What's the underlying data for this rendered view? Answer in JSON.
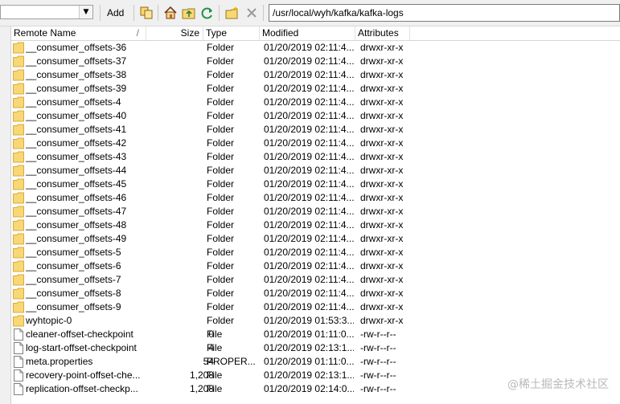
{
  "toolbar": {
    "add_label": "Add",
    "path": "/usr/local/wyh/kafka/kafka-logs",
    "icons": [
      "copy-icon",
      "home-icon",
      "parent-folder-icon",
      "refresh-icon",
      "new-folder-icon",
      "delete-icon"
    ]
  },
  "columns": {
    "name": "Remote Name",
    "name_sort": "/",
    "size": "Size",
    "type": "Type",
    "modified": "Modified",
    "attributes": "Attributes"
  },
  "files": [
    {
      "name": "__consumer_offsets-36",
      "size": "",
      "type": "Folder",
      "modified": "01/20/2019 02:11:4...",
      "attr": "drwxr-xr-x",
      "icon": "folder"
    },
    {
      "name": "__consumer_offsets-37",
      "size": "",
      "type": "Folder",
      "modified": "01/20/2019 02:11:4...",
      "attr": "drwxr-xr-x",
      "icon": "folder"
    },
    {
      "name": "__consumer_offsets-38",
      "size": "",
      "type": "Folder",
      "modified": "01/20/2019 02:11:4...",
      "attr": "drwxr-xr-x",
      "icon": "folder"
    },
    {
      "name": "__consumer_offsets-39",
      "size": "",
      "type": "Folder",
      "modified": "01/20/2019 02:11:4...",
      "attr": "drwxr-xr-x",
      "icon": "folder"
    },
    {
      "name": "__consumer_offsets-4",
      "size": "",
      "type": "Folder",
      "modified": "01/20/2019 02:11:4...",
      "attr": "drwxr-xr-x",
      "icon": "folder"
    },
    {
      "name": "__consumer_offsets-40",
      "size": "",
      "type": "Folder",
      "modified": "01/20/2019 02:11:4...",
      "attr": "drwxr-xr-x",
      "icon": "folder"
    },
    {
      "name": "__consumer_offsets-41",
      "size": "",
      "type": "Folder",
      "modified": "01/20/2019 02:11:4...",
      "attr": "drwxr-xr-x",
      "icon": "folder"
    },
    {
      "name": "__consumer_offsets-42",
      "size": "",
      "type": "Folder",
      "modified": "01/20/2019 02:11:4...",
      "attr": "drwxr-xr-x",
      "icon": "folder"
    },
    {
      "name": "__consumer_offsets-43",
      "size": "",
      "type": "Folder",
      "modified": "01/20/2019 02:11:4...",
      "attr": "drwxr-xr-x",
      "icon": "folder"
    },
    {
      "name": "__consumer_offsets-44",
      "size": "",
      "type": "Folder",
      "modified": "01/20/2019 02:11:4...",
      "attr": "drwxr-xr-x",
      "icon": "folder"
    },
    {
      "name": "__consumer_offsets-45",
      "size": "",
      "type": "Folder",
      "modified": "01/20/2019 02:11:4...",
      "attr": "drwxr-xr-x",
      "icon": "folder"
    },
    {
      "name": "__consumer_offsets-46",
      "size": "",
      "type": "Folder",
      "modified": "01/20/2019 02:11:4...",
      "attr": "drwxr-xr-x",
      "icon": "folder"
    },
    {
      "name": "__consumer_offsets-47",
      "size": "",
      "type": "Folder",
      "modified": "01/20/2019 02:11:4...",
      "attr": "drwxr-xr-x",
      "icon": "folder"
    },
    {
      "name": "__consumer_offsets-48",
      "size": "",
      "type": "Folder",
      "modified": "01/20/2019 02:11:4...",
      "attr": "drwxr-xr-x",
      "icon": "folder"
    },
    {
      "name": "__consumer_offsets-49",
      "size": "",
      "type": "Folder",
      "modified": "01/20/2019 02:11:4...",
      "attr": "drwxr-xr-x",
      "icon": "folder"
    },
    {
      "name": "__consumer_offsets-5",
      "size": "",
      "type": "Folder",
      "modified": "01/20/2019 02:11:4...",
      "attr": "drwxr-xr-x",
      "icon": "folder"
    },
    {
      "name": "__consumer_offsets-6",
      "size": "",
      "type": "Folder",
      "modified": "01/20/2019 02:11:4...",
      "attr": "drwxr-xr-x",
      "icon": "folder"
    },
    {
      "name": "__consumer_offsets-7",
      "size": "",
      "type": "Folder",
      "modified": "01/20/2019 02:11:4...",
      "attr": "drwxr-xr-x",
      "icon": "folder"
    },
    {
      "name": "__consumer_offsets-8",
      "size": "",
      "type": "Folder",
      "modified": "01/20/2019 02:11:4...",
      "attr": "drwxr-xr-x",
      "icon": "folder"
    },
    {
      "name": "__consumer_offsets-9",
      "size": "",
      "type": "Folder",
      "modified": "01/20/2019 02:11:4...",
      "attr": "drwxr-xr-x",
      "icon": "folder"
    },
    {
      "name": "wyhtopic-0",
      "size": "",
      "type": "Folder",
      "modified": "01/20/2019 01:53:3...",
      "attr": "drwxr-xr-x",
      "icon": "folder"
    },
    {
      "name": "cleaner-offset-checkpoint",
      "size": "0",
      "type": "File",
      "modified": "01/20/2019 01:11:0...",
      "attr": "-rw-r--r--",
      "icon": "file"
    },
    {
      "name": "log-start-offset-checkpoint",
      "size": "4",
      "type": "File",
      "modified": "01/20/2019 02:13:1...",
      "attr": "-rw-r--r--",
      "icon": "file"
    },
    {
      "name": "meta.properties",
      "size": "54",
      "type": "PROPER...",
      "modified": "01/20/2019 01:11:0...",
      "attr": "-rw-r--r--",
      "icon": "file"
    },
    {
      "name": "recovery-point-offset-che...",
      "size": "1,208",
      "type": "File",
      "modified": "01/20/2019 02:13:1...",
      "attr": "-rw-r--r--",
      "icon": "file"
    },
    {
      "name": "replication-offset-checkp...",
      "size": "1,208",
      "type": "File",
      "modified": "01/20/2019 02:14:0...",
      "attr": "-rw-r--r--",
      "icon": "file"
    }
  ],
  "watermark": "@稀土掘金技术社区",
  "colors": {
    "folder": "#f8d775",
    "folder_edge": "#d9ab3c",
    "toolbar": "#f0f0f0"
  }
}
